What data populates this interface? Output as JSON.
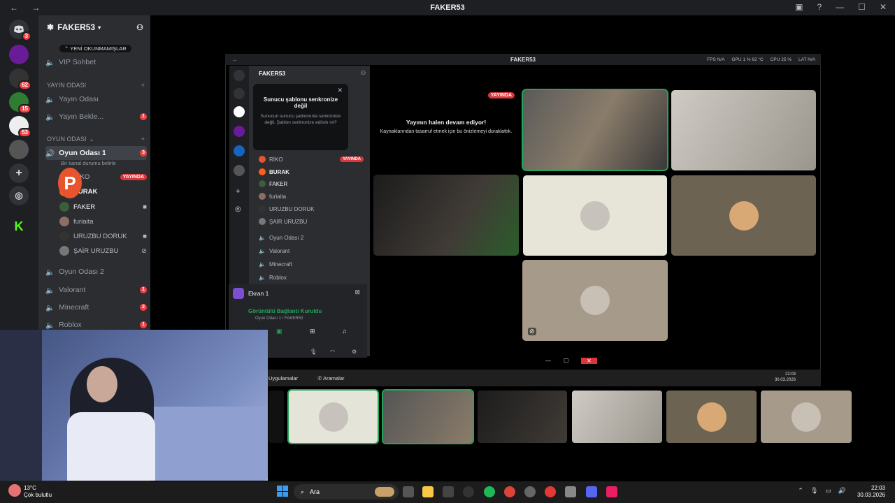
{
  "window": {
    "title": "FAKER53",
    "nav": "← →",
    "controls": [
      "▣",
      "?",
      "—",
      "☐",
      "✕"
    ]
  },
  "rail": {
    "servers": [
      {
        "name": "discord-home",
        "badge": "3",
        "color": "#5865f2"
      },
      {
        "name": "server-a",
        "badge": "",
        "color": "#8a2be2"
      },
      {
        "name": "server-b",
        "badge": "62",
        "color": "#3a3a3a"
      },
      {
        "name": "server-c",
        "badge": "15",
        "color": "#2e7d32"
      },
      {
        "name": "server-d",
        "badge": "53",
        "color": "#eeeeee"
      },
      {
        "name": "server-e",
        "badge": "",
        "color": "#444"
      }
    ]
  },
  "sidebar": {
    "server_name": "FAKER53",
    "unread_pill": "YENİ OKUNMAMIŞLAR",
    "top_channel": "VIP Sohbet",
    "categories": [
      {
        "name": "Yayın Odası",
        "channels": [
          {
            "label": "Yayın Odası",
            "badge": ""
          },
          {
            "label": "Yayın Bekle...",
            "badge": "1"
          }
        ]
      },
      {
        "name": "OYUN ODASI",
        "channels": [
          {
            "label": "Oyun Odası 1",
            "badge": "3"
          }
        ]
      }
    ],
    "status_line": "Bir kanal durumu belirle",
    "voice_users": [
      {
        "name": "RİKO",
        "live": "YAYINDA"
      },
      {
        "name": "BURAK",
        "live": ""
      },
      {
        "name": "FAKER",
        "live": ""
      },
      {
        "name": "furiaita",
        "live": ""
      },
      {
        "name": "URUZBU DORUK",
        "live": ""
      },
      {
        "name": "ŞAİR URUZBU",
        "live": ""
      }
    ],
    "more_channels": [
      {
        "label": "Oyun Odası 2",
        "badge": ""
      },
      {
        "label": "Valorant",
        "badge": "1"
      },
      {
        "label": "Minecraft",
        "badge": "2"
      },
      {
        "label": "Roblox",
        "badge": "1"
      }
    ]
  },
  "inner": {
    "title": "FAKER53",
    "stats": [
      "FPS N/A",
      "GPU 1 % 62 °C",
      "CPU 25 %",
      "LAT N/A"
    ],
    "server_name": "FAKER53",
    "popup": {
      "heading": "Sunucu şablonu senkronize değil",
      "body": "Sunucun sunucu şablonunla senkronize değil. Şablon senkronize edilsin mi?",
      "close": "✕"
    },
    "users": [
      {
        "name": "RİKO",
        "live": "YAYINDA"
      },
      {
        "name": "BURAK",
        "live": ""
      },
      {
        "name": "FAKER",
        "live": ""
      },
      {
        "name": "furiaita",
        "live": ""
      },
      {
        "name": "URUZBU DORUK",
        "live": ""
      },
      {
        "name": "ŞAİR URUZBU",
        "live": ""
      }
    ],
    "channels": [
      "Oyun Odası 2",
      "Valorant",
      "Minecraft",
      "Roblox"
    ],
    "screen_label": "Ekran 1",
    "connected": "Görüntülü Bağlantı Kuruldu",
    "connected_sub": "Oyun Odası 1 / FAKER53",
    "stream": {
      "live": "YAYINDA",
      "title": "Yayının halen devam ediyor!",
      "subtitle": "Kaynaklarından tasarruf etmek için bu önizlemeyi duraklattık."
    },
    "taskbar": {
      "apps": "Uygulamalar",
      "calls": "Aramalar",
      "time": "22:03",
      "date": "30.03.2026"
    }
  },
  "taskbar": {
    "weather_temp": "13°C",
    "weather_desc": "Çok bulutlu",
    "search": "Ara",
    "time": "22:03",
    "date": "30.03.2026"
  },
  "colors": {
    "live": "#da373c",
    "speaking": "#23a55a",
    "badge": "#f23f43",
    "accent": "#5865f2"
  }
}
